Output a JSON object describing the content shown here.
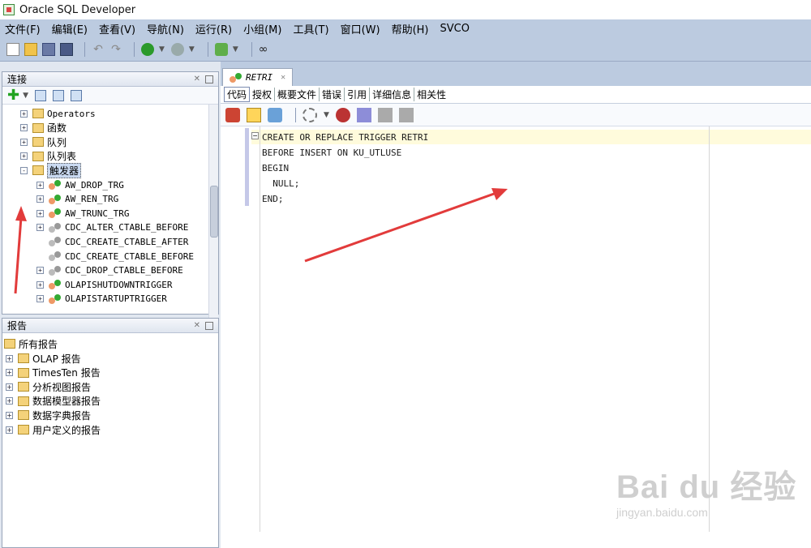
{
  "window": {
    "title": "Oracle SQL Developer"
  },
  "menu": [
    "文件(F)",
    "编辑(E)",
    "查看(V)",
    "导航(N)",
    "运行(R)",
    "小组(M)",
    "工具(T)",
    "窗口(W)",
    "帮助(H)",
    "SVCO"
  ],
  "connections": {
    "title": "连接",
    "items": [
      {
        "label": "Operators",
        "indent": 1,
        "expand": "+",
        "icon": "folder",
        "cjk": false
      },
      {
        "label": "函数",
        "indent": 1,
        "expand": "+",
        "icon": "folder",
        "cjk": true
      },
      {
        "label": "队列",
        "indent": 1,
        "expand": "+",
        "icon": "folder",
        "cjk": true
      },
      {
        "label": "队列表",
        "indent": 1,
        "expand": "+",
        "icon": "folder",
        "cjk": true
      },
      {
        "label": "触发器",
        "indent": 1,
        "expand": "-",
        "icon": "folder",
        "cjk": true,
        "selected": true
      },
      {
        "label": "AW_DROP_TRG",
        "indent": 2,
        "expand": "+",
        "icon": "trigger-valid"
      },
      {
        "label": "AW_REN_TRG",
        "indent": 2,
        "expand": "+",
        "icon": "trigger-valid"
      },
      {
        "label": "AW_TRUNC_TRG",
        "indent": 2,
        "expand": "+",
        "icon": "trigger-valid"
      },
      {
        "label": "CDC_ALTER_CTABLE_BEFORE",
        "indent": 2,
        "expand": "+",
        "icon": "trigger-disabled"
      },
      {
        "label": "CDC_CREATE_CTABLE_AFTER",
        "indent": 2,
        "expand": "",
        "icon": "trigger-disabled"
      },
      {
        "label": "CDC_CREATE_CTABLE_BEFORE",
        "indent": 2,
        "expand": "",
        "icon": "trigger-disabled"
      },
      {
        "label": "CDC_DROP_CTABLE_BEFORE",
        "indent": 2,
        "expand": "+",
        "icon": "trigger-disabled"
      },
      {
        "label": "OLAPISHUTDOWNTRIGGER",
        "indent": 2,
        "expand": "+",
        "icon": "trigger-valid"
      },
      {
        "label": "OLAPISTARTUPTRIGGER",
        "indent": 2,
        "expand": "+",
        "icon": "trigger-valid"
      }
    ]
  },
  "reports": {
    "title": "报告",
    "root": "所有报告",
    "items": [
      "OLAP 报告",
      "TimesTen 报告",
      "分析视图报告",
      "数据模型器报告",
      "数据字典报告",
      "用户定义的报告"
    ]
  },
  "editor": {
    "tab": "RETRI",
    "subtabs": [
      "代码",
      "授权",
      "概要文件",
      "错误",
      "引用",
      "详细信息",
      "相关性"
    ],
    "active_subtab": "代码",
    "code": [
      "CREATE OR REPLACE TRIGGER RETRI",
      "BEFORE INSERT ON KU_UTLUSE",
      "BEGIN",
      "  NULL;",
      "END;"
    ]
  },
  "watermark": {
    "brand": "Bai du 经验",
    "url": "jingyan.baidu.com"
  }
}
